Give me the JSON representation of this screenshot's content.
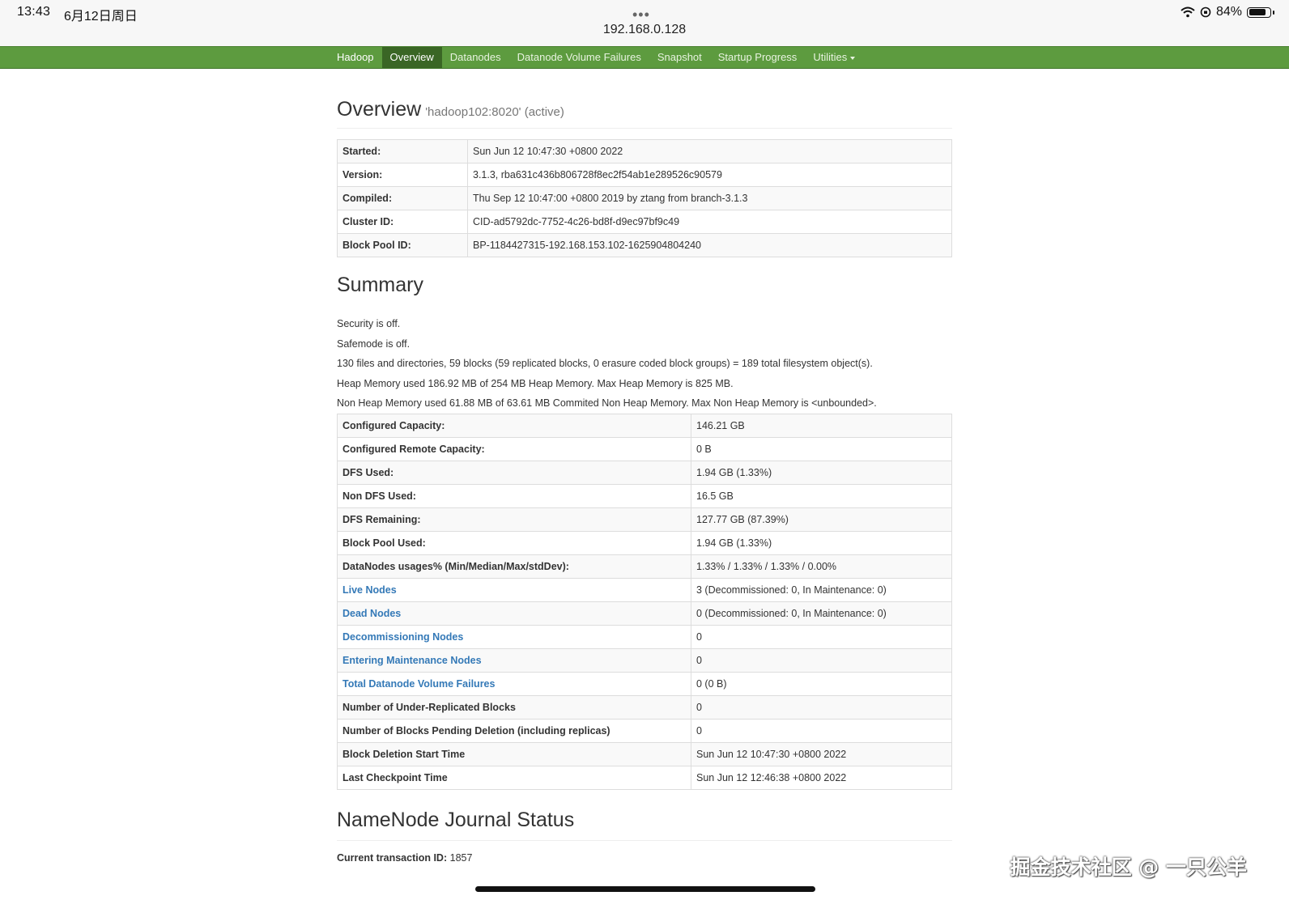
{
  "status_bar": {
    "time": "13:43",
    "date": "6月12日周日",
    "url": "192.168.0.128",
    "battery": "84%",
    "battery_level": 0.84
  },
  "navbar": {
    "brand": "Hadoop",
    "items": [
      {
        "label": "Overview",
        "active": true
      },
      {
        "label": "Datanodes",
        "active": false
      },
      {
        "label": "Datanode Volume Failures",
        "active": false
      },
      {
        "label": "Snapshot",
        "active": false
      },
      {
        "label": "Startup Progress",
        "active": false
      },
      {
        "label": "Utilities",
        "active": false
      }
    ],
    "color": "#5d9b3f"
  },
  "overview": {
    "title": "Overview",
    "subtitle": "'hadoop102:8020' (active)",
    "rows": [
      {
        "label": "Started:",
        "value": "Sun Jun 12 10:47:30 +0800 2022"
      },
      {
        "label": "Version:",
        "value": "3.1.3, rba631c436b806728f8ec2f54ab1e289526c90579"
      },
      {
        "label": "Compiled:",
        "value": "Thu Sep 12 10:47:00 +0800 2019 by ztang from branch-3.1.3"
      },
      {
        "label": "Cluster ID:",
        "value": "CID-ad5792dc-7752-4c26-bd8f-d9ec97bf9c49"
      },
      {
        "label": "Block Pool ID:",
        "value": "BP-1184427315-192.168.153.102-1625904804240"
      }
    ]
  },
  "summary": {
    "title": "Summary",
    "lines": [
      "Security is off.",
      "Safemode is off.",
      "130 files and directories, 59 blocks (59 replicated blocks, 0 erasure coded block groups) = 189 total filesystem object(s).",
      "Heap Memory used 186.92 MB of 254 MB Heap Memory. Max Heap Memory is 825 MB.",
      "Non Heap Memory used 61.88 MB of 63.61 MB Commited Non Heap Memory. Max Non Heap Memory is <unbounded>."
    ],
    "rows": [
      {
        "label": "Configured Capacity:",
        "value": "146.21 GB",
        "link": false
      },
      {
        "label": "Configured Remote Capacity:",
        "value": "0 B",
        "link": false
      },
      {
        "label": "DFS Used:",
        "value": "1.94 GB (1.33%)",
        "link": false
      },
      {
        "label": "Non DFS Used:",
        "value": "16.5 GB",
        "link": false
      },
      {
        "label": "DFS Remaining:",
        "value": "127.77 GB (87.39%)",
        "link": false
      },
      {
        "label": "Block Pool Used:",
        "value": "1.94 GB (1.33%)",
        "link": false
      },
      {
        "label": "DataNodes usages% (Min/Median/Max/stdDev):",
        "value": "1.33% / 1.33% / 1.33% / 0.00%",
        "link": false
      },
      {
        "label": "Live Nodes",
        "value": "3 (Decommissioned: 0, In Maintenance: 0)",
        "link": true
      },
      {
        "label": "Dead Nodes",
        "value": "0 (Decommissioned: 0, In Maintenance: 0)",
        "link": true
      },
      {
        "label": "Decommissioning Nodes",
        "value": "0",
        "link": true
      },
      {
        "label": "Entering Maintenance Nodes",
        "value": "0",
        "link": true
      },
      {
        "label": "Total Datanode Volume Failures",
        "value": "0 (0 B)",
        "link": true
      },
      {
        "label": "Number of Under-Replicated Blocks",
        "value": "0",
        "link": false
      },
      {
        "label": "Number of Blocks Pending Deletion (including replicas)",
        "value": "0",
        "link": false
      },
      {
        "label": "Block Deletion Start Time",
        "value": "Sun Jun 12 10:47:30 +0800 2022",
        "link": false
      },
      {
        "label": "Last Checkpoint Time",
        "value": "Sun Jun 12 12:46:38 +0800 2022",
        "link": false
      }
    ]
  },
  "journal": {
    "title": "NameNode Journal Status",
    "txid_label": "Current transaction ID:",
    "txid_value": "1857"
  },
  "watermark": "掘金技术社区 @ 一只公羊"
}
